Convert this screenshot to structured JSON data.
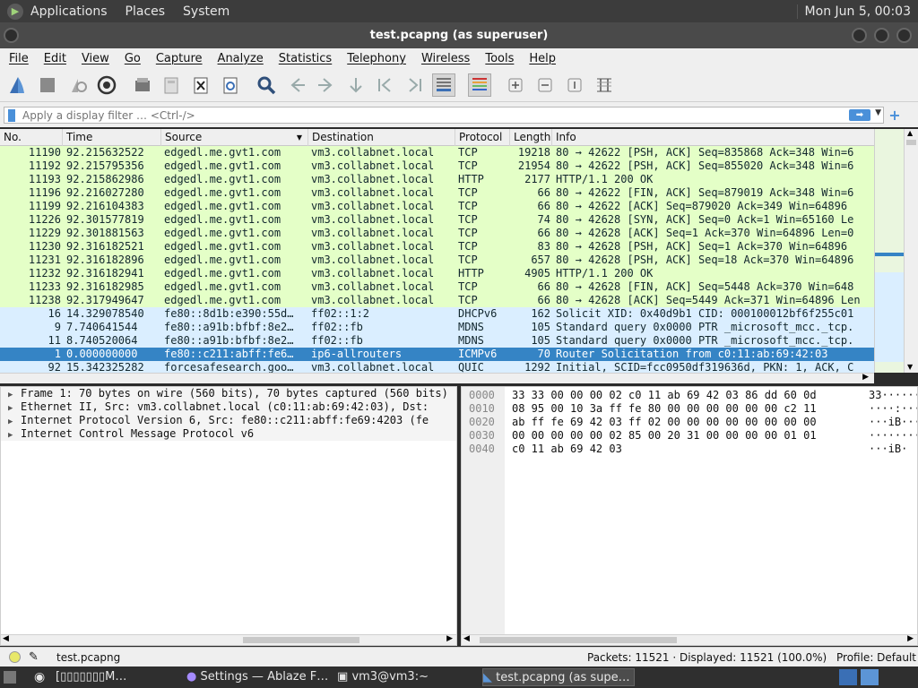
{
  "top_panel": {
    "menus": [
      "Applications",
      "Places",
      "System"
    ],
    "clock": "Mon Jun 5, 00:03"
  },
  "window": {
    "title": "test.pcapng (as superuser)"
  },
  "menubar": [
    "File",
    "Edit",
    "View",
    "Go",
    "Capture",
    "Analyze",
    "Statistics",
    "Telephony",
    "Wireless",
    "Tools",
    "Help"
  ],
  "filter": {
    "placeholder": "Apply a display filter … <Ctrl-/>"
  },
  "columns": [
    "No.",
    "Time",
    "Source",
    "Destination",
    "Protocol",
    "Length",
    "Info"
  ],
  "packets": [
    {
      "no": "11190",
      "time": "92.215632522",
      "src": "edgedl.me.gvt1.com",
      "dst": "vm3.collabnet.local",
      "proto": "TCP",
      "len": "19218",
      "info": "80 → 42622 [PSH, ACK] Seq=835868 Ack=348 Win=6",
      "color": "green"
    },
    {
      "no": "11192",
      "time": "92.215795356",
      "src": "edgedl.me.gvt1.com",
      "dst": "vm3.collabnet.local",
      "proto": "TCP",
      "len": "21954",
      "info": "80 → 42622 [PSH, ACK] Seq=855020 Ack=348 Win=6",
      "color": "green"
    },
    {
      "no": "11193",
      "time": "92.215862986",
      "src": "edgedl.me.gvt1.com",
      "dst": "vm3.collabnet.local",
      "proto": "HTTP",
      "len": "2177",
      "info": "HTTP/1.1 200 OK",
      "color": "green"
    },
    {
      "no": "11196",
      "time": "92.216027280",
      "src": "edgedl.me.gvt1.com",
      "dst": "vm3.collabnet.local",
      "proto": "TCP",
      "len": "66",
      "info": "80 → 42622 [FIN, ACK] Seq=879019 Ack=348 Win=6",
      "color": "green"
    },
    {
      "no": "11199",
      "time": "92.216104383",
      "src": "edgedl.me.gvt1.com",
      "dst": "vm3.collabnet.local",
      "proto": "TCP",
      "len": "66",
      "info": "80 → 42622 [ACK] Seq=879020 Ack=349 Win=64896",
      "color": "green"
    },
    {
      "no": "11226",
      "time": "92.301577819",
      "src": "edgedl.me.gvt1.com",
      "dst": "vm3.collabnet.local",
      "proto": "TCP",
      "len": "74",
      "info": "80 → 42628 [SYN, ACK] Seq=0 Ack=1 Win=65160 Le",
      "color": "green"
    },
    {
      "no": "11229",
      "time": "92.301881563",
      "src": "edgedl.me.gvt1.com",
      "dst": "vm3.collabnet.local",
      "proto": "TCP",
      "len": "66",
      "info": "80 → 42628 [ACK] Seq=1 Ack=370 Win=64896 Len=0",
      "color": "green"
    },
    {
      "no": "11230",
      "time": "92.316182521",
      "src": "edgedl.me.gvt1.com",
      "dst": "vm3.collabnet.local",
      "proto": "TCP",
      "len": "83",
      "info": "80 → 42628 [PSH, ACK] Seq=1 Ack=370 Win=64896",
      "color": "green"
    },
    {
      "no": "11231",
      "time": "92.316182896",
      "src": "edgedl.me.gvt1.com",
      "dst": "vm3.collabnet.local",
      "proto": "TCP",
      "len": "657",
      "info": "80 → 42628 [PSH, ACK] Seq=18 Ack=370 Win=64896",
      "color": "green"
    },
    {
      "no": "11232",
      "time": "92.316182941",
      "src": "edgedl.me.gvt1.com",
      "dst": "vm3.collabnet.local",
      "proto": "HTTP",
      "len": "4905",
      "info": "HTTP/1.1 200 OK",
      "color": "green"
    },
    {
      "no": "11233",
      "time": "92.316182985",
      "src": "edgedl.me.gvt1.com",
      "dst": "vm3.collabnet.local",
      "proto": "TCP",
      "len": "66",
      "info": "80 → 42628 [FIN, ACK] Seq=5448 Ack=370 Win=648",
      "color": "green"
    },
    {
      "no": "11238",
      "time": "92.317949647",
      "src": "edgedl.me.gvt1.com",
      "dst": "vm3.collabnet.local",
      "proto": "TCP",
      "len": "66",
      "info": "80 → 42628 [ACK] Seq=5449 Ack=371 Win=64896 Len",
      "color": "green"
    },
    {
      "no": "16",
      "time": "14.329078540",
      "src": "fe80::8d1b:e390:55d…",
      "dst": "ff02::1:2",
      "proto": "DHCPv6",
      "len": "162",
      "info": "Solicit XID: 0x40d9b1 CID: 000100012bf6f255c01",
      "color": "blue"
    },
    {
      "no": "9",
      "time": "7.740641544",
      "src": "fe80::a91b:bfbf:8e2…",
      "dst": "ff02::fb",
      "proto": "MDNS",
      "len": "105",
      "info": "Standard query 0x0000 PTR _microsoft_mcc._tcp.",
      "color": "blue"
    },
    {
      "no": "11",
      "time": "8.740520064",
      "src": "fe80::a91b:bfbf:8e2…",
      "dst": "ff02::fb",
      "proto": "MDNS",
      "len": "105",
      "info": "Standard query 0x0000 PTR _microsoft_mcc._tcp.",
      "color": "blue"
    },
    {
      "no": "1",
      "time": "0.000000000",
      "src": "fe80::c211:abff:fe6…",
      "dst": "ip6-allrouters",
      "proto": "ICMPv6",
      "len": "70",
      "info": "Router Solicitation from c0:11:ab:69:42:03",
      "color": "sel"
    },
    {
      "no": "92",
      "time": "15.342325282",
      "src": "forcesafesearch.goo…",
      "dst": "vm3.collabnet.local",
      "proto": "QUIC",
      "len": "1292",
      "info": "Initial, SCID=fcc0950df319636d, PKN: 1, ACK, C",
      "color": "blue"
    }
  ],
  "details": [
    "Frame 1: 70 bytes on wire (560 bits), 70 bytes captured (560 bits)",
    "Ethernet II, Src: vm3.collabnet.local (c0:11:ab:69:42:03), Dst: ",
    "Internet Protocol Version 6, Src: fe80::c211:abff:fe69:4203 (fe",
    "Internet Control Message Protocol v6"
  ],
  "bytes": [
    {
      "off": "0000",
      "hex": "33 33 00 00 00 02 c0 11  ab 69 42 03 86 dd 60 0d",
      "ascii": "33······"
    },
    {
      "off": "0010",
      "hex": "08 95 00 10 3a ff fe 80  00 00 00 00 00 00 c2 11",
      "ascii": "····:···"
    },
    {
      "off": "0020",
      "hex": "ab ff fe 69 42 03 ff 02  00 00 00 00 00 00 00 00",
      "ascii": "···iB···"
    },
    {
      "off": "0030",
      "hex": "00 00 00 00 00 02 85 00  20 31 00 00 00 00 01 01",
      "ascii": "········"
    },
    {
      "off": "0040",
      "hex": "c0 11 ab 69 42 03",
      "ascii": "···iB·"
    }
  ],
  "status": {
    "file": "test.pcapng",
    "packets": "Packets: 11521 · Displayed: 11521 (100.0%)",
    "profile": "Profile: Default"
  },
  "taskbar": {
    "tasks": [
      "[▯▯▯▯▯▯▯M…",
      "Settings — Ablaze F…",
      "vm3@vm3:~",
      "test.pcapng (as supe…"
    ]
  },
  "colors": {
    "accent": "#3584c5",
    "green_row": "#e4ffc7",
    "blue_row": "#daeeff"
  }
}
